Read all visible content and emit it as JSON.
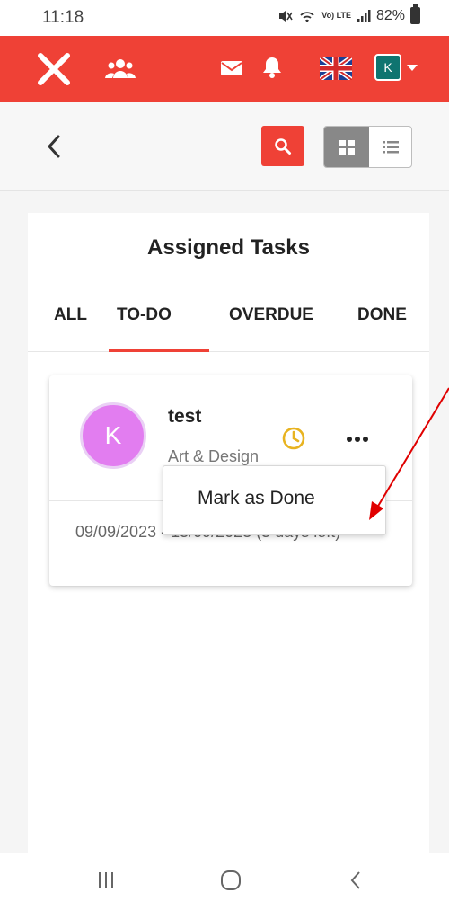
{
  "status_bar": {
    "time": "11:18",
    "network_label": "Vo) LTE",
    "battery": "82%"
  },
  "header": {
    "avatar_initial": "K",
    "brand_color": "#ef4136"
  },
  "panel": {
    "title": "Assigned Tasks",
    "tabs": [
      {
        "label": "ALL"
      },
      {
        "label": "TO-DO"
      },
      {
        "label": "OVERDUE"
      },
      {
        "label": "DONE"
      }
    ],
    "active_tab": "TO-DO"
  },
  "task": {
    "avatar_initial": "K",
    "name": "test",
    "category": "Art & Design",
    "dates": "09/09/2023 - 15/09/2023 (5 days left)"
  },
  "menu": {
    "mark_done": "Mark as Done"
  },
  "icons": {
    "logo": "x-logo-icon",
    "users": "users-icon",
    "mail": "mail-icon",
    "bell": "bell-icon",
    "flag": "uk-flag-icon",
    "search": "search-icon",
    "grid": "grid-icon",
    "list": "list-icon",
    "clock": "clock-icon",
    "more": "more-icon"
  },
  "colors": {
    "accent": "#ef4136",
    "avatar_header": "#0f7470",
    "task_avatar": "#e27df0",
    "clock": "#e8b320",
    "annotation": "#e00000"
  }
}
